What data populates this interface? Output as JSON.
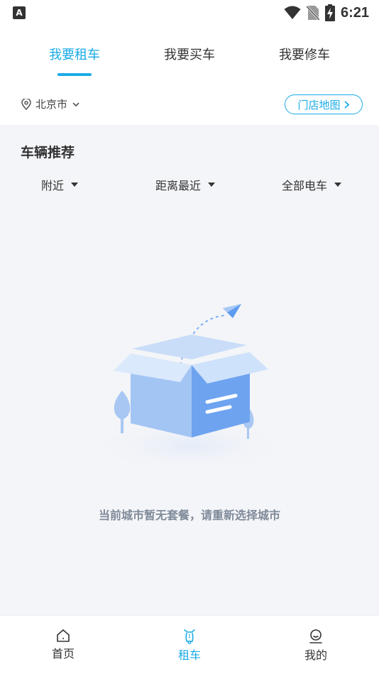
{
  "status_bar": {
    "app_badge": "A",
    "time": "6:21",
    "icons": [
      "wifi-icon",
      "no-sim-icon",
      "battery-charging-icon"
    ]
  },
  "tabs": [
    {
      "label": "我要租车",
      "active": true
    },
    {
      "label": "我要买车",
      "active": false
    },
    {
      "label": "我要修车",
      "active": false
    }
  ],
  "location": {
    "city": "北京市",
    "map_button": "门店地图"
  },
  "section": {
    "title": "车辆推荐"
  },
  "filters": [
    {
      "label": "附近"
    },
    {
      "label": "距离最近"
    },
    {
      "label": "全部电车"
    }
  ],
  "empty_state": {
    "message": "当前城市暂无套餐，请重新选择城市"
  },
  "bottom_nav": [
    {
      "label": "首页",
      "icon": "home-icon",
      "active": false
    },
    {
      "label": "租车",
      "icon": "scooter-icon",
      "active": true
    },
    {
      "label": "我的",
      "icon": "profile-icon",
      "active": false
    }
  ],
  "colors": {
    "accent": "#1aabe8",
    "background": "#f4f5f8",
    "empty_text": "#7f8a99"
  }
}
